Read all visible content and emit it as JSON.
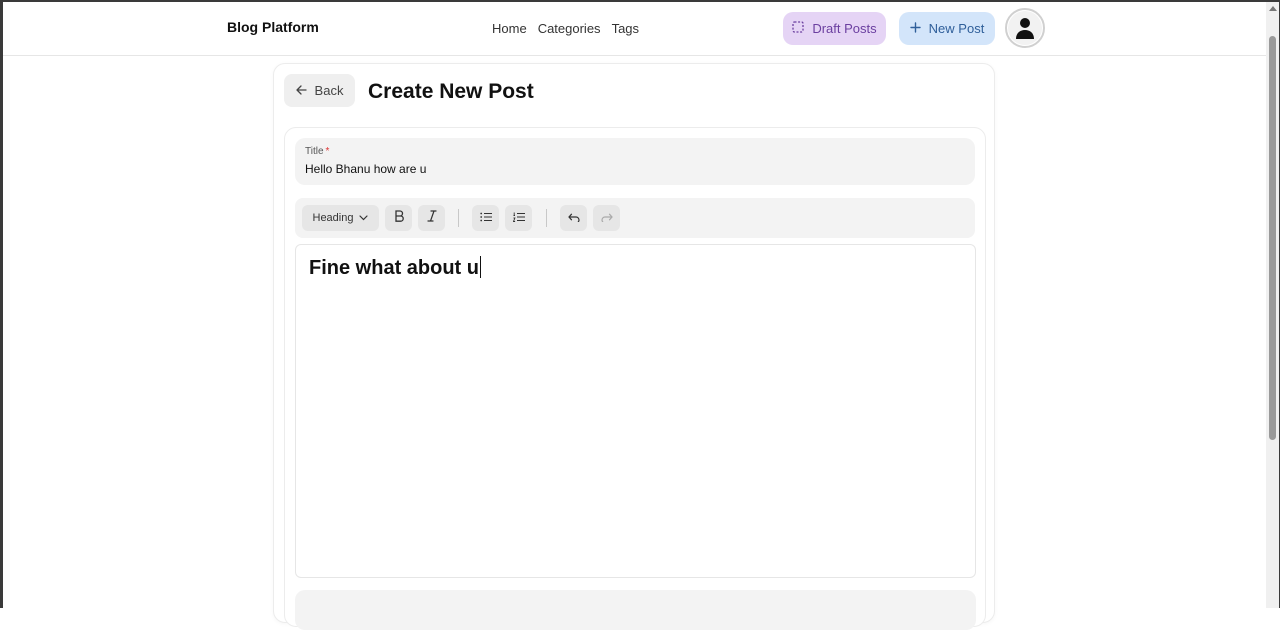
{
  "navbar": {
    "brand": "Blog Platform",
    "links": [
      {
        "label": "Home"
      },
      {
        "label": "Categories"
      },
      {
        "label": "Tags"
      }
    ],
    "draft_label": "Draft Posts",
    "new_label": "New Post",
    "draft_icon": "dashed-square-icon",
    "new_icon": "plus-icon",
    "avatar_icon": "user-icon"
  },
  "colors": {
    "draft_bg": "#e5d4f5",
    "draft_text": "#6b3fa0",
    "new_bg": "#d3e5fa",
    "new_text": "#2f5f9a",
    "required": "#dd3333"
  },
  "page": {
    "back_label": "Back",
    "title": "Create New Post"
  },
  "form": {
    "title_label": "Title",
    "title_required_mark": "*",
    "title_value": "Hello Bhanu how are u"
  },
  "toolbar": {
    "block_type": "Heading",
    "buttons": [
      "bold-icon",
      "italic-icon",
      "bullet-list-icon",
      "ordered-list-icon",
      "undo-icon",
      "redo-icon"
    ]
  },
  "editor": {
    "content": "Fine what about u"
  }
}
